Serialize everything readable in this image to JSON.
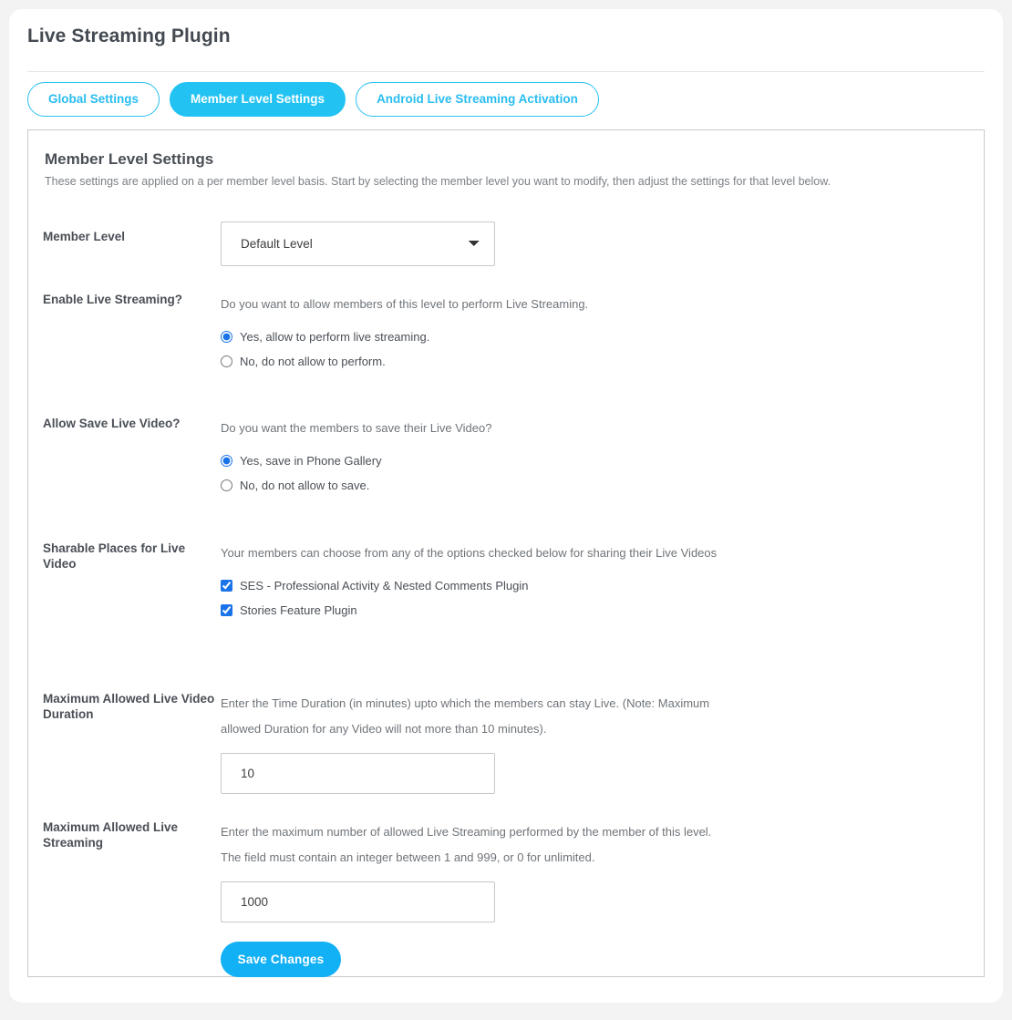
{
  "header": {
    "title": "Live Streaming Plugin"
  },
  "tabs": [
    {
      "label": "Global Settings",
      "active": false
    },
    {
      "label": "Member Level Settings",
      "active": true
    },
    {
      "label": "Android Live Streaming Activation",
      "active": false
    }
  ],
  "panel": {
    "title": "Member Level Settings",
    "subtitle": "These settings are applied on a per member level basis. Start by selecting the member level you want to modify, then adjust the settings for that level below."
  },
  "fields": {
    "member_level": {
      "label": "Member Level",
      "selected": "Default Level",
      "options": [
        "Default Level"
      ]
    },
    "enable_live_streaming": {
      "label": "Enable Live Streaming?",
      "help": "Do you want to allow members of this level to perform Live Streaming.",
      "options": [
        {
          "label": "Yes, allow to perform live streaming.",
          "checked": true
        },
        {
          "label": "No, do not allow to perform.",
          "checked": false
        }
      ]
    },
    "allow_save_live_video": {
      "label": "Allow Save Live Video?",
      "help": "Do you want the members to save their Live Video?",
      "options": [
        {
          "label": "Yes, save in Phone Gallery",
          "checked": true
        },
        {
          "label": "No, do not allow to save.",
          "checked": false
        }
      ]
    },
    "sharable_places": {
      "label": "Sharable Places for Live Video",
      "help": "Your members can choose from any of the options checked below for sharing their Live Videos",
      "options": [
        {
          "label": "SES - Professional Activity & Nested Comments Plugin",
          "checked": true
        },
        {
          "label": "Stories Feature Plugin",
          "checked": true
        }
      ]
    },
    "max_video_duration": {
      "label": "Maximum Allowed Live Video Duration",
      "help": "Enter the Time Duration (in minutes) upto which the members can stay Live. (Note: Maximum allowed Duration for any Video will not more than 10 minutes).",
      "value": "10"
    },
    "max_live_streaming": {
      "label": "Maximum Allowed Live Streaming",
      "help": "Enter the maximum number of allowed Live Streaming performed by the member of this level. The field must contain an integer between 1 and 999, or 0 for unlimited.",
      "value": "1000"
    }
  },
  "actions": {
    "save_label": "Save Changes"
  },
  "colors": {
    "accent": "#22c3f2",
    "accent_button": "#12b0f5",
    "text": "#4a4f56",
    "help_text": "#6f7479",
    "page_bg": "#f3f3f4"
  }
}
